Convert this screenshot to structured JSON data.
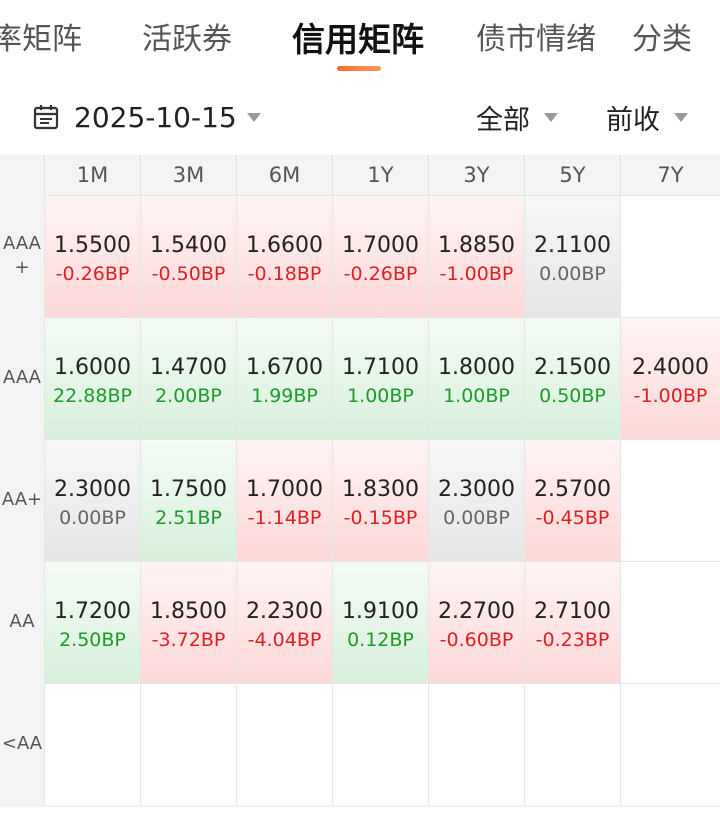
{
  "tabs": [
    {
      "label": "率矩阵",
      "active": false
    },
    {
      "label": "活跃券",
      "active": false
    },
    {
      "label": "信用矩阵",
      "active": true
    },
    {
      "label": "债市情绪",
      "active": false
    },
    {
      "label": "分类",
      "active": false
    }
  ],
  "filters": {
    "date": "2025-10-15",
    "scope": "全部",
    "compare": "前收"
  },
  "matrix": {
    "columns": [
      "1M",
      "3M",
      "6M",
      "1Y",
      "3Y",
      "5Y",
      "7Y"
    ],
    "rows": [
      {
        "label": "AAA+",
        "cells": [
          {
            "value": "1.5500",
            "change": "-0.26BP",
            "trend": "up"
          },
          {
            "value": "1.5400",
            "change": "-0.50BP",
            "trend": "up"
          },
          {
            "value": "1.6600",
            "change": "-0.18BP",
            "trend": "up"
          },
          {
            "value": "1.7000",
            "change": "-0.26BP",
            "trend": "up"
          },
          {
            "value": "1.8850",
            "change": "-1.00BP",
            "trend": "up"
          },
          {
            "value": "2.1100",
            "change": "0.00BP",
            "trend": "flat"
          },
          {
            "value": "",
            "change": "",
            "trend": "empty"
          }
        ]
      },
      {
        "label": "AAA",
        "cells": [
          {
            "value": "1.6000",
            "change": "22.88BP",
            "trend": "down"
          },
          {
            "value": "1.4700",
            "change": "2.00BP",
            "trend": "down"
          },
          {
            "value": "1.6700",
            "change": "1.99BP",
            "trend": "down"
          },
          {
            "value": "1.7100",
            "change": "1.00BP",
            "trend": "down"
          },
          {
            "value": "1.8000",
            "change": "1.00BP",
            "trend": "down"
          },
          {
            "value": "2.1500",
            "change": "0.50BP",
            "trend": "down"
          },
          {
            "value": "2.4000",
            "change": "-1.00BP",
            "trend": "up"
          }
        ]
      },
      {
        "label": "AA+",
        "cells": [
          {
            "value": "2.3000",
            "change": "0.00BP",
            "trend": "flat"
          },
          {
            "value": "1.7500",
            "change": "2.51BP",
            "trend": "down"
          },
          {
            "value": "1.7000",
            "change": "-1.14BP",
            "trend": "up"
          },
          {
            "value": "1.8300",
            "change": "-0.15BP",
            "trend": "up"
          },
          {
            "value": "2.3000",
            "change": "0.00BP",
            "trend": "flat"
          },
          {
            "value": "2.5700",
            "change": "-0.45BP",
            "trend": "up"
          },
          {
            "value": "",
            "change": "",
            "trend": "empty"
          }
        ]
      },
      {
        "label": "AA",
        "cells": [
          {
            "value": "1.7200",
            "change": "2.50BP",
            "trend": "down"
          },
          {
            "value": "1.8500",
            "change": "-3.72BP",
            "trend": "up"
          },
          {
            "value": "2.2300",
            "change": "-4.04BP",
            "trend": "up"
          },
          {
            "value": "1.9100",
            "change": "0.12BP",
            "trend": "down"
          },
          {
            "value": "2.2700",
            "change": "-0.60BP",
            "trend": "up"
          },
          {
            "value": "2.7100",
            "change": "-0.23BP",
            "trend": "up"
          },
          {
            "value": "",
            "change": "",
            "trend": "empty"
          }
        ]
      },
      {
        "label": "<AA",
        "cells": [
          {
            "value": "",
            "change": "",
            "trend": "empty"
          },
          {
            "value": "",
            "change": "",
            "trend": "empty"
          },
          {
            "value": "",
            "change": "",
            "trend": "empty"
          },
          {
            "value": "",
            "change": "",
            "trend": "empty"
          },
          {
            "value": "",
            "change": "",
            "trend": "empty"
          },
          {
            "value": "",
            "change": "",
            "trend": "empty"
          },
          {
            "value": "",
            "change": "",
            "trend": "empty"
          }
        ]
      }
    ]
  },
  "icons": {
    "date": "calendar-icon",
    "dropdown": "caret-down-icon"
  },
  "colors": {
    "accent": "#ff6a2a",
    "negative_change": "#e02020",
    "positive_change": "#1a9c2a",
    "neutral_change": "#666666"
  }
}
